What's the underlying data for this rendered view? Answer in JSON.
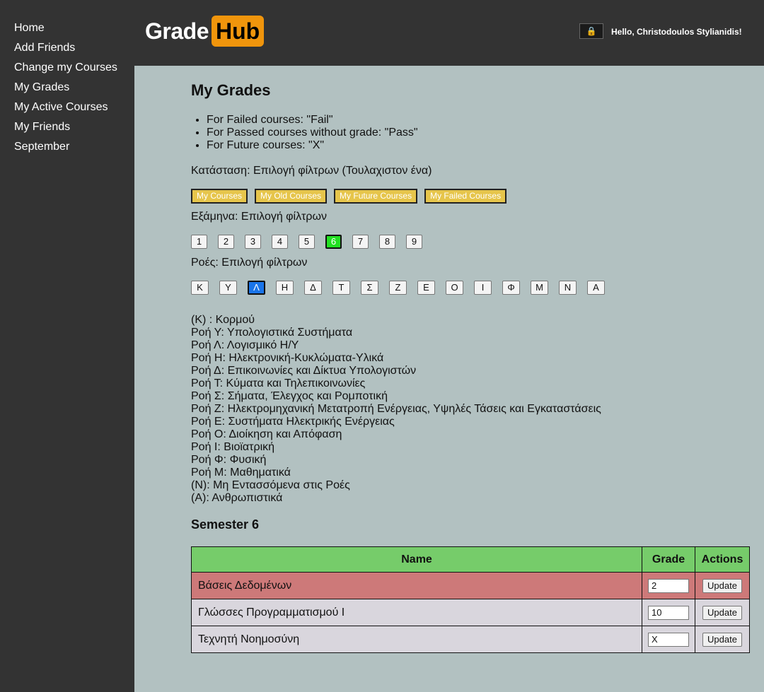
{
  "sidebar": {
    "items": [
      "Home",
      "Add Friends",
      "Change my Courses",
      "My Grades",
      "My Active Courses",
      "My Friends",
      "September"
    ]
  },
  "header": {
    "logo_left": "Grade",
    "logo_right": "Hub",
    "lock_icon": "🔒",
    "greeting": "Hello, Christodoulos Stylianidis!"
  },
  "page": {
    "title": "My Grades",
    "info": [
      "For Failed courses: \"Fail\"",
      "For Passed courses without grade: \"Pass\"",
      "For Future courses: \"X\""
    ],
    "status_line": "Κατάσταση: Επιλογή φίλτρων (Τουλαχιστον ένα)",
    "filters": [
      "My Courses",
      "My Old Courses",
      "My Future Courses",
      "My Failed Courses"
    ],
    "semesters_label": "Εξάμηνα: Επιλογή φίλτρων",
    "semesters": [
      "1",
      "2",
      "3",
      "4",
      "5",
      "6",
      "7",
      "8",
      "9"
    ],
    "selected_semester": "6",
    "flows_label": "Ροές: Επιλογή φίλτρων",
    "flows": [
      "Κ",
      "Υ",
      "Λ",
      "Η",
      "Δ",
      "Τ",
      "Σ",
      "Ζ",
      "Ε",
      "Ο",
      "Ι",
      "Φ",
      "Μ",
      "Ν",
      "Α"
    ],
    "selected_flow": "Λ",
    "legend": [
      "(Κ) : Κορμού",
      "Ροή Υ: Υπολογιστικά Συστήματα",
      "Ροή Λ: Λογισμικό Η/Υ",
      "Ροή Η: Ηλεκτρονική-Κυκλώματα-Υλικά",
      "Ροή Δ: Επικοινωνίες και Δίκτυα Υπολογιστών",
      "Ροή Τ: Κύματα και Τηλεπικοινωνίες",
      "Ροή Σ: Σήματα, Έλεγχος και Ρομποτική",
      "Ροή Ζ: Ηλεκτρομηχανική Μετατροπή Ενέργειας, Υψηλές Τάσεις και Εγκαταστάσεις",
      "Ροή Ε: Συστήματα Ηλεκτρικής Ενέργειας",
      "Ροή Ο: Διοίκηση και Απόφαση",
      "Ροή Ι: Βιοϊατρική",
      "Ροή Φ: Φυσική",
      "Ροή Μ: Μαθηματικά",
      "(Ν): Μη Εντασσόμενα στις Ροές",
      "(Α): Ανθρωπιστικά"
    ],
    "semester_heading": "Semester 6"
  },
  "table": {
    "headers": [
      "Name",
      "Grade",
      "Actions"
    ],
    "rows": [
      {
        "name": "Βάσεις Δεδομένων",
        "grade": "2",
        "action": "Update",
        "failed": true
      },
      {
        "name": "Γλώσσες Προγραμματισμού Ι",
        "grade": "10",
        "action": "Update",
        "failed": false
      },
      {
        "name": "Τεχνητή Νοημοσύνη",
        "grade": "X",
        "action": "Update",
        "failed": false
      }
    ]
  },
  "colors": {
    "sidebar_bg": "#333333",
    "main_bg": "#b2c1c1",
    "logo_accent": "#f0950c",
    "filter_button": "#e6c54b",
    "semester_selected": "#22e022",
    "flow_selected": "#1a74e8",
    "table_header": "#76cc6a",
    "failed_row": "#cd7979",
    "normal_row": "#d9d6dd"
  }
}
